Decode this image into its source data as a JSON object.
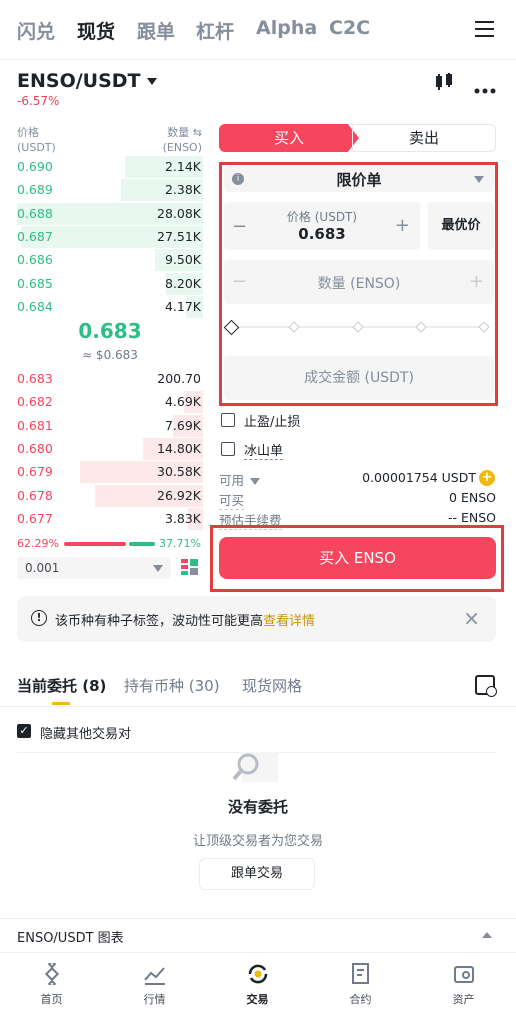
{
  "nav": {
    "tabs": [
      "闪兑",
      "现货",
      "跟单",
      "杠杆",
      "Alpha",
      "C2C"
    ],
    "active_index": 1
  },
  "pair": {
    "name": "ENSO/USDT",
    "change": "-6.57%"
  },
  "orderbook": {
    "price_header": "价格",
    "price_unit": "(USDT)",
    "qty_header": "数量",
    "qty_unit": "(ENSO)",
    "asks": [
      {
        "price": "0.690",
        "qty": "2.14K",
        "depth": 0.42
      },
      {
        "price": "0.689",
        "qty": "2.38K",
        "depth": 0.44
      },
      {
        "price": "0.688",
        "qty": "28.08K",
        "depth": 1.0
      },
      {
        "price": "0.687",
        "qty": "27.51K",
        "depth": 0.98
      },
      {
        "price": "0.686",
        "qty": "9.50K",
        "depth": 0.26
      },
      {
        "price": "0.685",
        "qty": "8.20K",
        "depth": 0.2
      },
      {
        "price": "0.684",
        "qty": "4.17K",
        "depth": 0.09
      }
    ],
    "mid_price": "0.683",
    "mid_usd": "≈ $0.683",
    "bids": [
      {
        "price": "0.683",
        "qty": "200.70",
        "depth": 0.0
      },
      {
        "price": "0.682",
        "qty": "4.69K",
        "depth": 0.1
      },
      {
        "price": "0.681",
        "qty": "7.69K",
        "depth": 0.16
      },
      {
        "price": "0.680",
        "qty": "14.80K",
        "depth": 0.32
      },
      {
        "price": "0.679",
        "qty": "30.58K",
        "depth": 0.66
      },
      {
        "price": "0.678",
        "qty": "26.92K",
        "depth": 0.58
      },
      {
        "price": "0.677",
        "qty": "3.83K",
        "depth": 0.08
      }
    ],
    "buy_ratio": "62.29%",
    "sell_ratio": "37.71%",
    "precision": "0.001"
  },
  "form": {
    "buy_tab": "买入",
    "sell_tab": "卖出",
    "order_type": "限价单",
    "price_label": "价格 (USDT)",
    "price_value": "0.683",
    "best_price": "最优价",
    "qty_placeholder": "数量 (ENSO)",
    "amount_placeholder": "成交金额 (USDT)",
    "tpsl": "止盈/止损",
    "iceberg": "冰山单",
    "avail_label": "可用",
    "avail_value": "0.00001754 USDT",
    "can_buy_label": "可买",
    "can_buy_value": "0 ENSO",
    "fee_label": "预估手续费",
    "fee_value": "-- ENSO",
    "submit": "买入 ENSO"
  },
  "notice": {
    "text": "该币种有种子标签，波动性可能更高",
    "link": "查看详情"
  },
  "orders": {
    "tabs": [
      "当前委托 (8)",
      "持有币种 (30)",
      "现货网格"
    ],
    "hide_pairs": "隐藏其他交易对",
    "empty_title": "没有委托",
    "empty_sub": "让顶级交易者为您交易",
    "copy_btn": "跟单交易"
  },
  "chart_bar": {
    "label": "ENSO/USDT 图表"
  },
  "bottom_nav": [
    "首页",
    "行情",
    "交易",
    "合约",
    "资产"
  ],
  "colors": {
    "green": "#2ebd85",
    "red": "#f6465d",
    "highlight": "#e23c3c",
    "accent": "#f0b90b"
  }
}
